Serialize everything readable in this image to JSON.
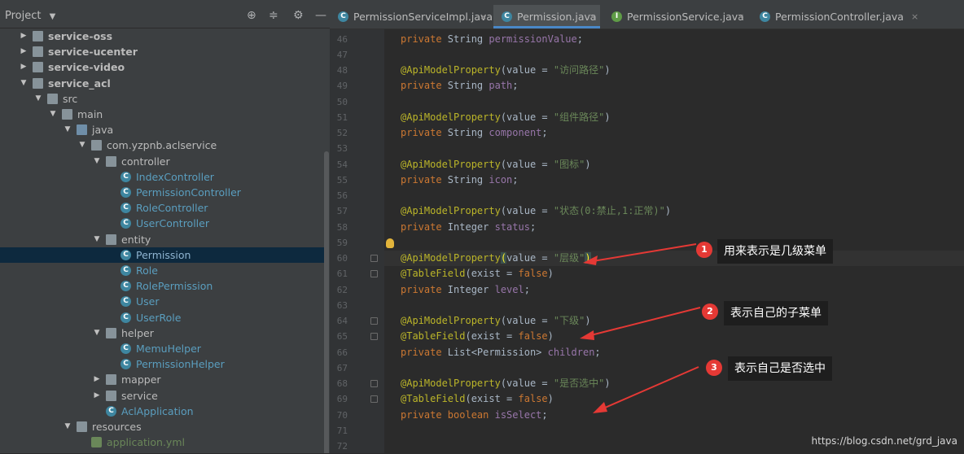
{
  "project": {
    "title": "Project"
  },
  "tree": [
    {
      "label": "service-oss",
      "indent": 27,
      "arrow": "▶",
      "type": "folder",
      "style": "bold"
    },
    {
      "label": "service-ucenter",
      "indent": 27,
      "arrow": "▶",
      "type": "folder",
      "style": "bold"
    },
    {
      "label": "service-video",
      "indent": 27,
      "arrow": "▶",
      "type": "folder",
      "style": "bold"
    },
    {
      "label": "service_acl",
      "indent": 27,
      "arrow": "▼",
      "type": "folder",
      "style": "bold"
    },
    {
      "label": "src",
      "indent": 45,
      "arrow": "▼",
      "type": "folder",
      "style": "norm"
    },
    {
      "label": "main",
      "indent": 63,
      "arrow": "▼",
      "type": "folder",
      "style": "norm"
    },
    {
      "label": "java",
      "indent": 81,
      "arrow": "▼",
      "type": "folder-blue",
      "style": "norm"
    },
    {
      "label": "com.yzpnb.aclservice",
      "indent": 99,
      "arrow": "▼",
      "type": "folder",
      "style": "norm"
    },
    {
      "label": "controller",
      "indent": 117,
      "arrow": "▼",
      "type": "folder",
      "style": "norm"
    },
    {
      "label": "IndexController",
      "indent": 135,
      "arrow": "",
      "type": "class",
      "style": "cls"
    },
    {
      "label": "PermissionController",
      "indent": 135,
      "arrow": "",
      "type": "class",
      "style": "cls"
    },
    {
      "label": "RoleController",
      "indent": 135,
      "arrow": "",
      "type": "class",
      "style": "cls"
    },
    {
      "label": "UserController",
      "indent": 135,
      "arrow": "",
      "type": "class",
      "style": "cls"
    },
    {
      "label": "entity",
      "indent": 117,
      "arrow": "▼",
      "type": "folder",
      "style": "norm"
    },
    {
      "label": "Permission",
      "indent": 135,
      "arrow": "",
      "type": "class",
      "style": "sel",
      "selected": true
    },
    {
      "label": "Role",
      "indent": 135,
      "arrow": "",
      "type": "class",
      "style": "cls"
    },
    {
      "label": "RolePermission",
      "indent": 135,
      "arrow": "",
      "type": "class",
      "style": "cls"
    },
    {
      "label": "User",
      "indent": 135,
      "arrow": "",
      "type": "class",
      "style": "cls"
    },
    {
      "label": "UserRole",
      "indent": 135,
      "arrow": "",
      "type": "class",
      "style": "cls"
    },
    {
      "label": "helper",
      "indent": 117,
      "arrow": "▼",
      "type": "folder",
      "style": "norm"
    },
    {
      "label": "MemuHelper",
      "indent": 135,
      "arrow": "",
      "type": "class",
      "style": "cls"
    },
    {
      "label": "PermissionHelper",
      "indent": 135,
      "arrow": "",
      "type": "class",
      "style": "cls"
    },
    {
      "label": "mapper",
      "indent": 117,
      "arrow": "▶",
      "type": "folder",
      "style": "norm"
    },
    {
      "label": "service",
      "indent": 117,
      "arrow": "▶",
      "type": "folder",
      "style": "norm"
    },
    {
      "label": "AclApplication",
      "indent": 117,
      "arrow": "",
      "type": "class",
      "style": "cls"
    },
    {
      "label": "resources",
      "indent": 81,
      "arrow": "▼",
      "type": "folder",
      "style": "norm"
    },
    {
      "label": "application.yml",
      "indent": 99,
      "arrow": "",
      "type": "yml",
      "style": "yml"
    }
  ],
  "tabs": [
    {
      "label": "PermissionServiceImpl.java",
      "icon": "C",
      "active": false
    },
    {
      "label": "Permission.java",
      "icon": "C",
      "active": true
    },
    {
      "label": "PermissionService.java",
      "icon": "I",
      "active": false
    },
    {
      "label": "PermissionController.java",
      "icon": "C",
      "active": false
    }
  ],
  "line_numbers": [
    "46",
    "47",
    "48",
    "49",
    "50",
    "51",
    "52",
    "53",
    "54",
    "55",
    "56",
    "57",
    "58",
    "59",
    "60",
    "61",
    "62",
    "63",
    "64",
    "65",
    "66",
    "67",
    "68",
    "69",
    "70",
    "71",
    "72"
  ],
  "code_lines": [
    {
      "n": "46",
      "parts": [
        [
          "kw",
          "private "
        ],
        [
          "",
          "String "
        ],
        [
          "fld",
          "permissionValue"
        ],
        [
          "",
          ";"
        ]
      ]
    },
    {
      "n": "47",
      "parts": []
    },
    {
      "n": "48",
      "parts": [
        [
          "ann",
          "@ApiModelProperty"
        ],
        [
          "",
          "(value = "
        ],
        [
          "str",
          "\"访问路径\""
        ],
        [
          "",
          ")"
        ]
      ]
    },
    {
      "n": "49",
      "parts": [
        [
          "kw",
          "private "
        ],
        [
          "",
          "String "
        ],
        [
          "fld",
          "path"
        ],
        [
          "",
          ";"
        ]
      ]
    },
    {
      "n": "50",
      "parts": []
    },
    {
      "n": "51",
      "parts": [
        [
          "ann",
          "@ApiModelProperty"
        ],
        [
          "",
          "(value = "
        ],
        [
          "str",
          "\"组件路径\""
        ],
        [
          "",
          ")"
        ]
      ]
    },
    {
      "n": "52",
      "parts": [
        [
          "kw",
          "private "
        ],
        [
          "",
          "String "
        ],
        [
          "fld",
          "component"
        ],
        [
          "",
          ";"
        ]
      ]
    },
    {
      "n": "53",
      "parts": []
    },
    {
      "n": "54",
      "parts": [
        [
          "ann",
          "@ApiModelProperty"
        ],
        [
          "",
          "(value = "
        ],
        [
          "str",
          "\"图标\""
        ],
        [
          "",
          ")"
        ]
      ]
    },
    {
      "n": "55",
      "parts": [
        [
          "kw",
          "private "
        ],
        [
          "",
          "String "
        ],
        [
          "fld",
          "icon"
        ],
        [
          "",
          ";"
        ]
      ]
    },
    {
      "n": "56",
      "parts": []
    },
    {
      "n": "57",
      "parts": [
        [
          "ann",
          "@ApiModelProperty"
        ],
        [
          "",
          "(value = "
        ],
        [
          "str",
          "\"状态(0:禁止,1:正常)\""
        ],
        [
          "",
          ")"
        ]
      ]
    },
    {
      "n": "58",
      "parts": [
        [
          "kw",
          "private "
        ],
        [
          "",
          "Integer "
        ],
        [
          "fld",
          "status"
        ],
        [
          "",
          ";"
        ]
      ]
    },
    {
      "n": "59",
      "parts": []
    },
    {
      "n": "60",
      "parts": [
        [
          "ann",
          "@ApiModelProperty"
        ],
        [
          "hl",
          "("
        ],
        [
          "",
          "value = "
        ],
        [
          "str",
          "\"层级\""
        ],
        [
          "hl",
          ")"
        ]
      ]
    },
    {
      "n": "61",
      "parts": [
        [
          "ann",
          "@TableField"
        ],
        [
          "",
          "(exist = "
        ],
        [
          "kw",
          "false"
        ],
        [
          "",
          ")"
        ]
      ]
    },
    {
      "n": "62",
      "parts": [
        [
          "kw",
          "private "
        ],
        [
          "",
          "Integer "
        ],
        [
          "fld",
          "level"
        ],
        [
          "",
          ";"
        ]
      ]
    },
    {
      "n": "63",
      "parts": []
    },
    {
      "n": "64",
      "parts": [
        [
          "ann",
          "@ApiModelProperty"
        ],
        [
          "",
          "(value = "
        ],
        [
          "str",
          "\"下级\""
        ],
        [
          "",
          ")"
        ]
      ]
    },
    {
      "n": "65",
      "parts": [
        [
          "ann",
          "@TableField"
        ],
        [
          "",
          "(exist = "
        ],
        [
          "kw",
          "false"
        ],
        [
          "",
          ")"
        ]
      ]
    },
    {
      "n": "66",
      "parts": [
        [
          "kw",
          "private "
        ],
        [
          "",
          "List<Permission> "
        ],
        [
          "fld",
          "children"
        ],
        [
          "",
          ";"
        ]
      ]
    },
    {
      "n": "67",
      "parts": []
    },
    {
      "n": "68",
      "parts": [
        [
          "ann",
          "@ApiModelProperty"
        ],
        [
          "",
          "(value = "
        ],
        [
          "str",
          "\"是否选中\""
        ],
        [
          "",
          ")"
        ]
      ]
    },
    {
      "n": "69",
      "parts": [
        [
          "ann",
          "@TableField"
        ],
        [
          "",
          "(exist = "
        ],
        [
          "kw",
          "false"
        ],
        [
          "",
          ")"
        ]
      ]
    },
    {
      "n": "70",
      "parts": [
        [
          "kw",
          "private boolean "
        ],
        [
          "fld",
          "isSelect"
        ],
        [
          "",
          ";"
        ]
      ]
    },
    {
      "n": "71",
      "parts": []
    },
    {
      "n": "72",
      "parts": []
    }
  ],
  "callouts": [
    {
      "num": "1",
      "text": "用来表示是几级菜单"
    },
    {
      "num": "2",
      "text": "表示自己的子菜单"
    },
    {
      "num": "3",
      "text": "表示自己是否选中"
    }
  ],
  "watermark": "https://blog.csdn.net/grd_java",
  "colors": {
    "annotation_red": "#e53935",
    "selection": "#0d293e",
    "tab_active_underline": "#4a88c7"
  },
  "icons": {
    "panel_header": [
      "crosshair-icon",
      "collapse-icon",
      "gear-icon",
      "minimize-icon"
    ]
  }
}
